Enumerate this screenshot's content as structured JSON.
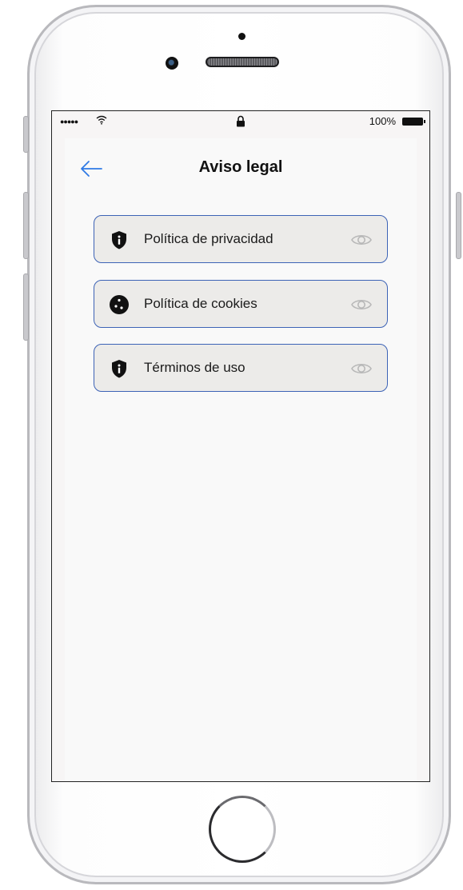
{
  "statusbar": {
    "signal": "●●●●●",
    "battery_percent": "100%"
  },
  "header": {
    "title": "Aviso legal"
  },
  "items": [
    {
      "label": "Política de privacidad",
      "icon": "shield-info-icon",
      "action_icon": "eye-icon"
    },
    {
      "label": "Política de cookies",
      "icon": "cookie-icon",
      "action_icon": "eye-icon"
    },
    {
      "label": "Términos de uso",
      "icon": "shield-info-icon",
      "action_icon": "eye-icon"
    }
  ],
  "colors": {
    "accent": "#2f7ae5",
    "item_border": "#3d63b6",
    "item_bg": "#ecebe9",
    "eye": "#b8b8b8"
  }
}
